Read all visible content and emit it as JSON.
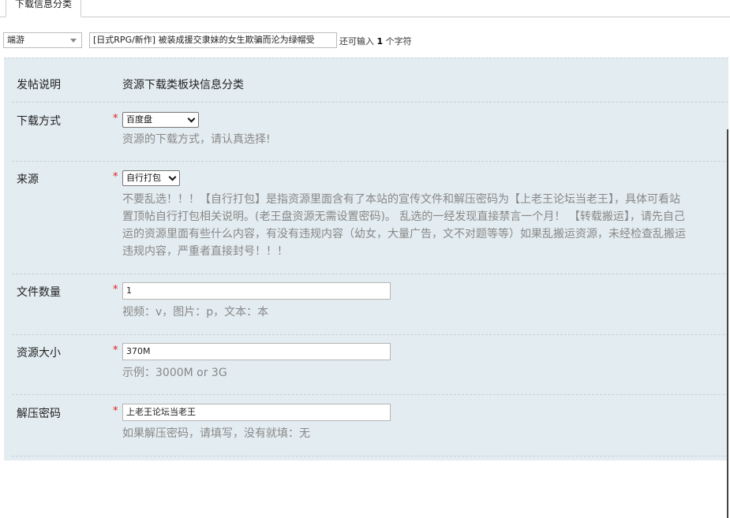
{
  "tab": {
    "label": "下载信息分类"
  },
  "title_row": {
    "type_value": "端游",
    "title_value": "[日式RPG/新作] 被装成援交隶妹的女生欺骗而沦为绿帽受",
    "hint_prefix": "还可输入",
    "hint_count": "1",
    "hint_suffix": "个字符"
  },
  "form": {
    "desc": {
      "label": "发帖说明",
      "value": "资源下载类板块信息分类"
    },
    "download": {
      "label": "下载方式",
      "required": "*",
      "value": "百度盘",
      "tip": "资源的下载方式，请认真选择!"
    },
    "source": {
      "label": "来源",
      "required": "*",
      "value": "自行打包",
      "tip_lines": [
        "不要乱选！！！【自行打包】是指资源里面含有了本站的宣传文件和解压密码为【上老王论坛当老王】，具体可看站",
        "置顶帖自行打包相关说明。(老王盘资源无需设置密码)。 乱选的一经发现直接禁言一个月！ 【转载搬运】，请先自己",
        "运的资源里面有些什么内容，有没有违规内容（幼女，大量广告，文不对题等等）如果乱搬运资源，未经检查乱搬运",
        "违规内容，严重者直接封号！！！"
      ]
    },
    "files": {
      "label": "文件数量",
      "required": "*",
      "value": "1",
      "tip": "视频：v，图片：p，文本：本"
    },
    "size": {
      "label": "资源大小",
      "required": "*",
      "value": "370M",
      "tip": "示例：3000M or 3G"
    },
    "password": {
      "label": "解压密码",
      "required": "*",
      "value": "上老王论坛当老王",
      "tip": "如果解压密码，请填写，没有就填：无"
    }
  },
  "colors": {
    "panel_bg": "#e3ecf0",
    "required": "#e02020",
    "tip": "#888888"
  }
}
